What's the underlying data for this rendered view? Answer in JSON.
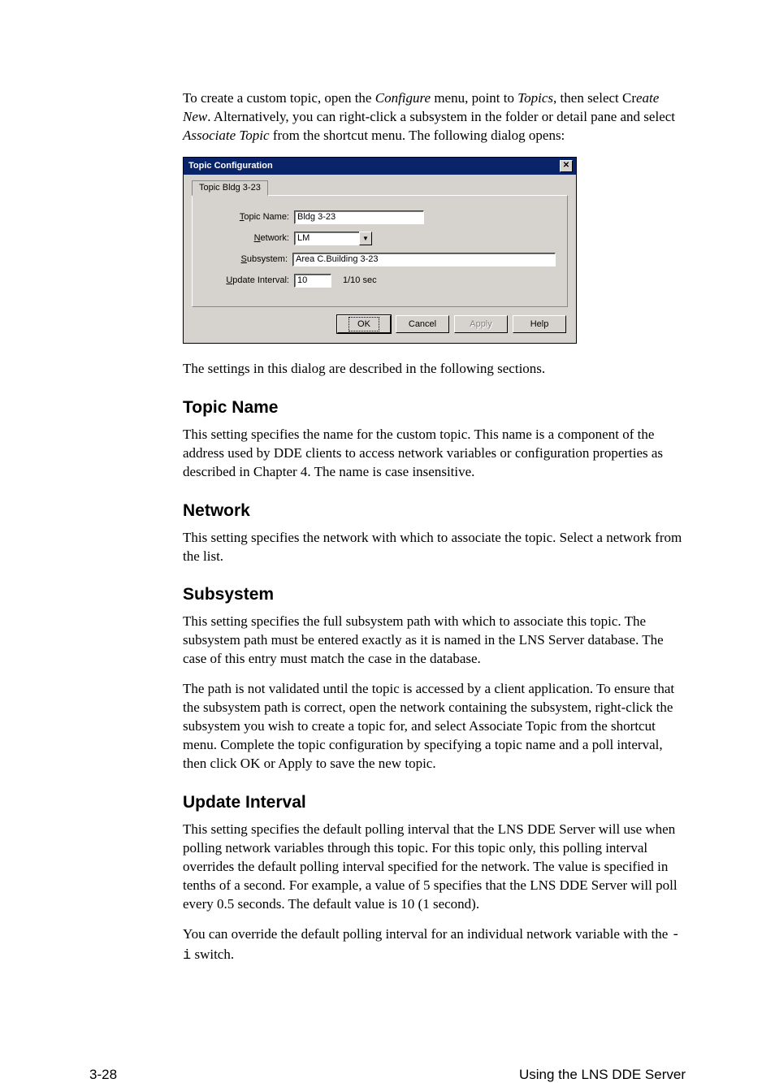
{
  "intro": {
    "part1": "To create a custom topic, open the ",
    "menu1": "Configure",
    "part2": " menu, point to ",
    "menu2": "Topics",
    "part3": ", then select Cr",
    "menu3": "eate New",
    "part4": ".  Alternatively, you can right-click a subsystem in the folder or detail pane and select ",
    "menu4": "Associate Topic",
    "part5": " from the shortcut menu.  The following dialog opens:"
  },
  "dialog": {
    "title": "Topic Configuration",
    "tab": "Topic Bldg 3-23",
    "fields": {
      "topic_name": {
        "label": "Topic Name:",
        "value": "Bldg 3-23"
      },
      "network": {
        "label": "Network:",
        "value": "LM"
      },
      "subsystem": {
        "label": "Subsystem:",
        "value": "Area C.Building 3-23"
      },
      "update": {
        "label": "Update Interval:",
        "value": "10",
        "suffix": "1/10 sec"
      }
    },
    "buttons": {
      "ok": "OK",
      "cancel": "Cancel",
      "apply": "Apply",
      "help": "Help"
    }
  },
  "after_dialog": "The settings in this dialog are described in the following sections.",
  "sections": {
    "topic_name": {
      "heading": "Topic Name",
      "p1": "This setting specifies the name for the custom topic.  This name is a component of the address used by DDE clients to access network variables or configuration properties as described in Chapter 4.  The name is case insensitive."
    },
    "network": {
      "heading": "Network",
      "p1": "This setting specifies the network with which to associate the topic.  Select a network from the list."
    },
    "subsystem": {
      "heading": "Subsystem",
      "p1": "This setting specifies the full subsystem path with which to associate this topic.  The subsystem path must be entered exactly as it is named in the LNS Server database.  The case of this entry must match the case in the database.",
      "p2": "The path is not validated until the topic is accessed by a client application. To ensure that the subsystem path is correct, open the network containing the subsystem, right-click the subsystem you wish to create a topic for, and select Associate Topic from the shortcut menu.  Complete the topic configuration by specifying a topic name and a poll interval, then click OK or Apply to save the new topic."
    },
    "update": {
      "heading": "Update Interval",
      "p1": "This setting specifies the default polling interval that the LNS DDE Server will use when polling network variables through this topic.  For this topic only, this polling interval overrides the default polling interval specified for the network.  The value is specified in tenths of a second.  For example, a value of 5 specifies that the LNS DDE Server will poll every 0.5 seconds.  The default value is 10 (1 second).",
      "p2a": "You can override the default polling interval for an individual network variable with the ",
      "switch": "-i",
      "p2b": " switch."
    }
  },
  "footer": {
    "page": "3-28",
    "title": "Using the LNS DDE Server"
  }
}
